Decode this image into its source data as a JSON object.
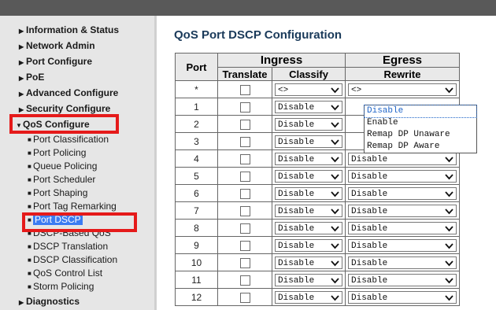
{
  "nav": {
    "top_items": [
      "Information & Status",
      "Network Admin",
      "Port Configure",
      "PoE",
      "Advanced Configure",
      "Security Configure"
    ],
    "qos_label": "QoS Configure",
    "qos_sub": [
      "Port Classification",
      "Port Policing",
      "Queue Policing",
      "Port Scheduler",
      "Port Shaping",
      "Port Tag Remarking",
      "Port DSCP",
      "DSCP-Based QoS",
      "DSCP Translation",
      "DSCP Classification",
      "QoS Control List",
      "Storm Policing"
    ],
    "bottom_item": "Diagnostics",
    "active_sub": "Port DSCP"
  },
  "page": {
    "title": "QoS Port DSCP Configuration"
  },
  "table": {
    "headers": {
      "port": "Port",
      "ingress": "Ingress",
      "egress": "Egress",
      "translate": "Translate",
      "classify": "Classify",
      "rewrite": "Rewrite"
    },
    "star_row": {
      "port": "*",
      "classify": "<>",
      "rewrite": "<>"
    },
    "rows": [
      {
        "port": "1",
        "classify": "Disable",
        "rewrite": "Disable"
      },
      {
        "port": "2",
        "classify": "Disable",
        "rewrite": "Disable"
      },
      {
        "port": "3",
        "classify": "Disable",
        "rewrite": "Disable"
      },
      {
        "port": "4",
        "classify": "Disable",
        "rewrite": "Disable"
      },
      {
        "port": "5",
        "classify": "Disable",
        "rewrite": "Disable"
      },
      {
        "port": "6",
        "classify": "Disable",
        "rewrite": "Disable"
      },
      {
        "port": "7",
        "classify": "Disable",
        "rewrite": "Disable"
      },
      {
        "port": "8",
        "classify": "Disable",
        "rewrite": "Disable"
      },
      {
        "port": "9",
        "classify": "Disable",
        "rewrite": "Disable"
      },
      {
        "port": "10",
        "classify": "Disable",
        "rewrite": "Disable"
      },
      {
        "port": "11",
        "classify": "Disable",
        "rewrite": "Disable"
      },
      {
        "port": "12",
        "classify": "Disable",
        "rewrite": "Disable"
      }
    ]
  },
  "rewrite_dropdown": {
    "options": [
      "Disable",
      "Enable",
      "Remap DP Unaware",
      "Remap DP Aware"
    ],
    "highlighted": "Disable"
  },
  "colors": {
    "highlight_red": "#e51a1a",
    "active_blue": "#3c7cf2",
    "title_color": "#1a3a5a"
  }
}
